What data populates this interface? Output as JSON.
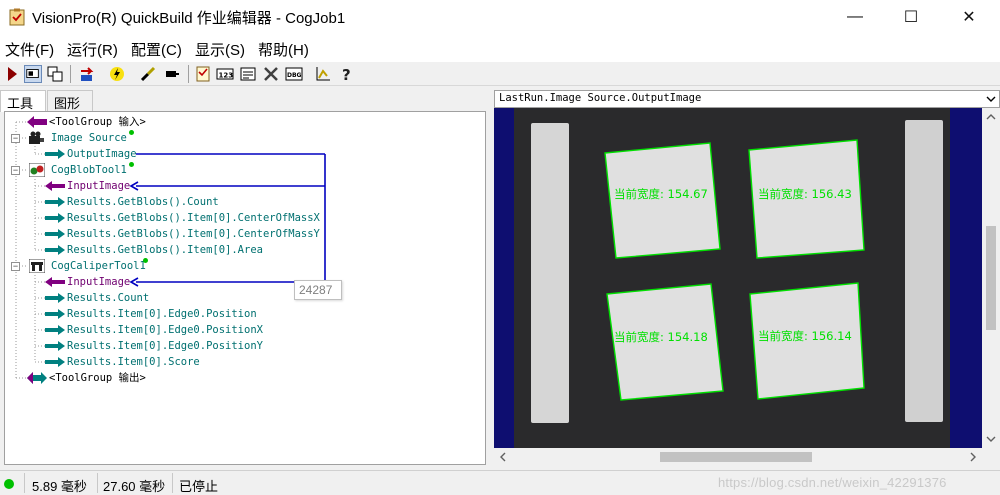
{
  "window": {
    "title": "VisionPro(R) QuickBuild 作业编辑器 - CogJob1",
    "minimize_glyph": "—",
    "maximize_glyph": "☐",
    "close_glyph": "✕"
  },
  "menu": {
    "items": [
      "文件(F)",
      "运行(R)",
      "配置(C)",
      "显示(S)",
      "帮助(H)"
    ]
  },
  "toolbar": {
    "icons": [
      "run-icon",
      "display-icon",
      "copy-icon",
      "reset-icon",
      "lightning-icon",
      "brush-icon",
      "terminal-icon",
      "checklist-icon",
      "numeric-icon",
      "form-icon",
      "tools-icon",
      "dbg-icon",
      "chart-icon",
      "help-icon"
    ]
  },
  "left_panel": {
    "tabs": [
      "工具",
      "图形"
    ],
    "tree": {
      "input_group": "<ToolGroup 输入>",
      "image_source": "Image Source",
      "image_source_output": "OutputImage",
      "blob_tool": "CogBlobTool1",
      "blob_items": [
        "InputImage",
        "Results.GetBlobs().Count",
        "Results.GetBlobs().Item[0].CenterOfMassX",
        "Results.GetBlobs().Item[0].CenterOfMassY",
        "Results.GetBlobs().Item[0].Area"
      ],
      "caliper_tool": "CogCaliperTool1",
      "caliper_items": [
        "InputImage",
        "Results.Count",
        "Results.Item[0].Edge0.Position",
        "Results.Item[0].Edge0.PositionX",
        "Results.Item[0].Edge0.PositionY",
        "Results.Item[0].Score"
      ],
      "output_group": "<ToolGroup 输出>"
    },
    "tooltip": "24287"
  },
  "right_panel": {
    "image_title": "LastRun.Image Source.OutputImage",
    "labels": [
      "当前宽度: 154.67",
      "当前宽度: 156.43",
      "当前宽度: 154.18",
      "当前宽度: 156.14"
    ]
  },
  "status": {
    "time1": "5.89 毫秒",
    "time2": "27.60 毫秒",
    "state": "已停止",
    "watermark": "https://blog.csdn.net/weixin_42291376"
  },
  "colors": {
    "link_line": "#0000c0",
    "output_arrow": "#008080",
    "input_arrow": "#800080",
    "status_ok": "#00c000",
    "image_bg": "#0e0e70",
    "overlay_green": "#00e000"
  }
}
